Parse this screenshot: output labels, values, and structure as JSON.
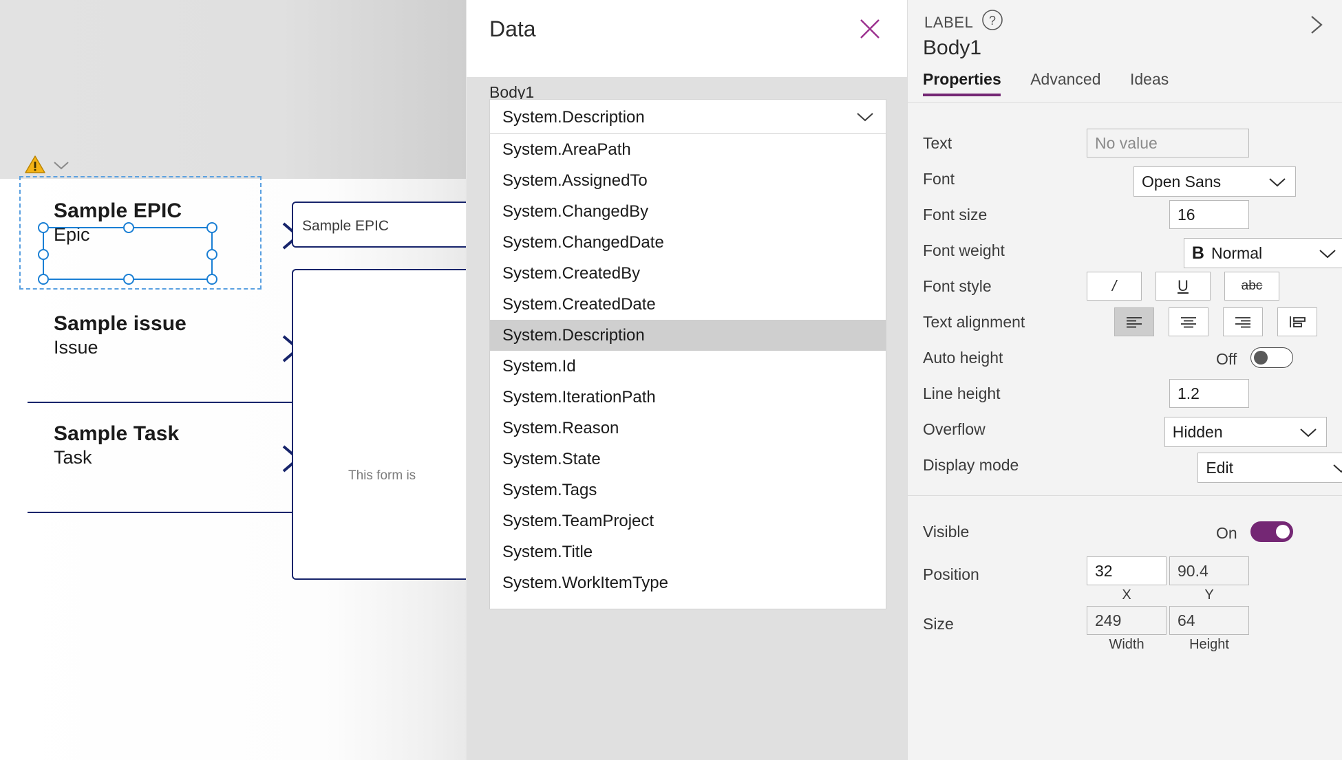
{
  "canvas": {
    "warning_icon": "warning-triangle-icon",
    "expand_icon": "chevron-down-icon",
    "gallery_items": [
      {
        "title": "Sample EPIC",
        "subtitle": "Epic"
      },
      {
        "title": "Sample issue",
        "subtitle": "Issue"
      },
      {
        "title": "Sample Task",
        "subtitle": "Task"
      }
    ],
    "form_card_label": "Sample EPIC",
    "form_placeholder": "This form is",
    "chevron_icon": "chevron-right-icon"
  },
  "data_panel": {
    "title": "Data",
    "close_icon": "close-icon",
    "field_label": "Body1",
    "selected_value": "System.Description",
    "dropdown_chevron": "chevron-down-icon",
    "options": [
      "System.AreaPath",
      "System.AssignedTo",
      "System.ChangedBy",
      "System.ChangedDate",
      "System.CreatedBy",
      "System.CreatedDate",
      "System.Description",
      "System.Id",
      "System.IterationPath",
      "System.Reason",
      "System.State",
      "System.Tags",
      "System.TeamProject",
      "System.Title",
      "System.WorkItemType"
    ],
    "selected_index": 6
  },
  "properties": {
    "control_type": "LABEL",
    "help_icon": "question-circle-icon",
    "collapse_icon": "chevron-right-icon",
    "control_name": "Body1",
    "tabs": [
      {
        "label": "Properties",
        "active": true
      },
      {
        "label": "Advanced",
        "active": false
      },
      {
        "label": "Ideas",
        "active": false
      }
    ],
    "rows": {
      "text": {
        "label": "Text",
        "placeholder": "No value",
        "value": ""
      },
      "font": {
        "label": "Font",
        "value": "Open Sans"
      },
      "font_size": {
        "label": "Font size",
        "value": "16"
      },
      "font_weight": {
        "label": "Font weight",
        "value": "Normal",
        "bold_glyph": "B"
      },
      "font_style": {
        "label": "Font style",
        "buttons": [
          {
            "name": "italic-button",
            "glyph": "/",
            "active": false
          },
          {
            "name": "underline-button",
            "glyph": "U",
            "active": false
          },
          {
            "name": "strikethrough-button",
            "glyph": "abc",
            "active": false
          }
        ]
      },
      "text_alignment": {
        "label": "Text alignment",
        "buttons": [
          {
            "name": "align-left-button",
            "active": true
          },
          {
            "name": "align-center-button",
            "active": false
          },
          {
            "name": "align-right-button",
            "active": false
          },
          {
            "name": "align-justify-button",
            "active": false
          }
        ]
      },
      "auto_height": {
        "label": "Auto height",
        "state": "Off",
        "on": false
      },
      "line_height": {
        "label": "Line height",
        "value": "1.2"
      },
      "overflow": {
        "label": "Overflow",
        "value": "Hidden"
      },
      "display_mode": {
        "label": "Display mode",
        "value": "Edit"
      },
      "visible": {
        "label": "Visible",
        "state": "On",
        "on": true
      },
      "position": {
        "label": "Position",
        "x": "32",
        "y": "90.4",
        "x_caption": "X",
        "y_caption": "Y"
      },
      "size": {
        "label": "Size",
        "width": "249",
        "height": "64",
        "width_caption": "Width",
        "height_caption": "Height"
      }
    }
  },
  "colors": {
    "accent_purple": "#742774",
    "selection_blue": "#1a7fd4",
    "card_navy": "#17246b",
    "warning_amber": "#f5b315"
  }
}
